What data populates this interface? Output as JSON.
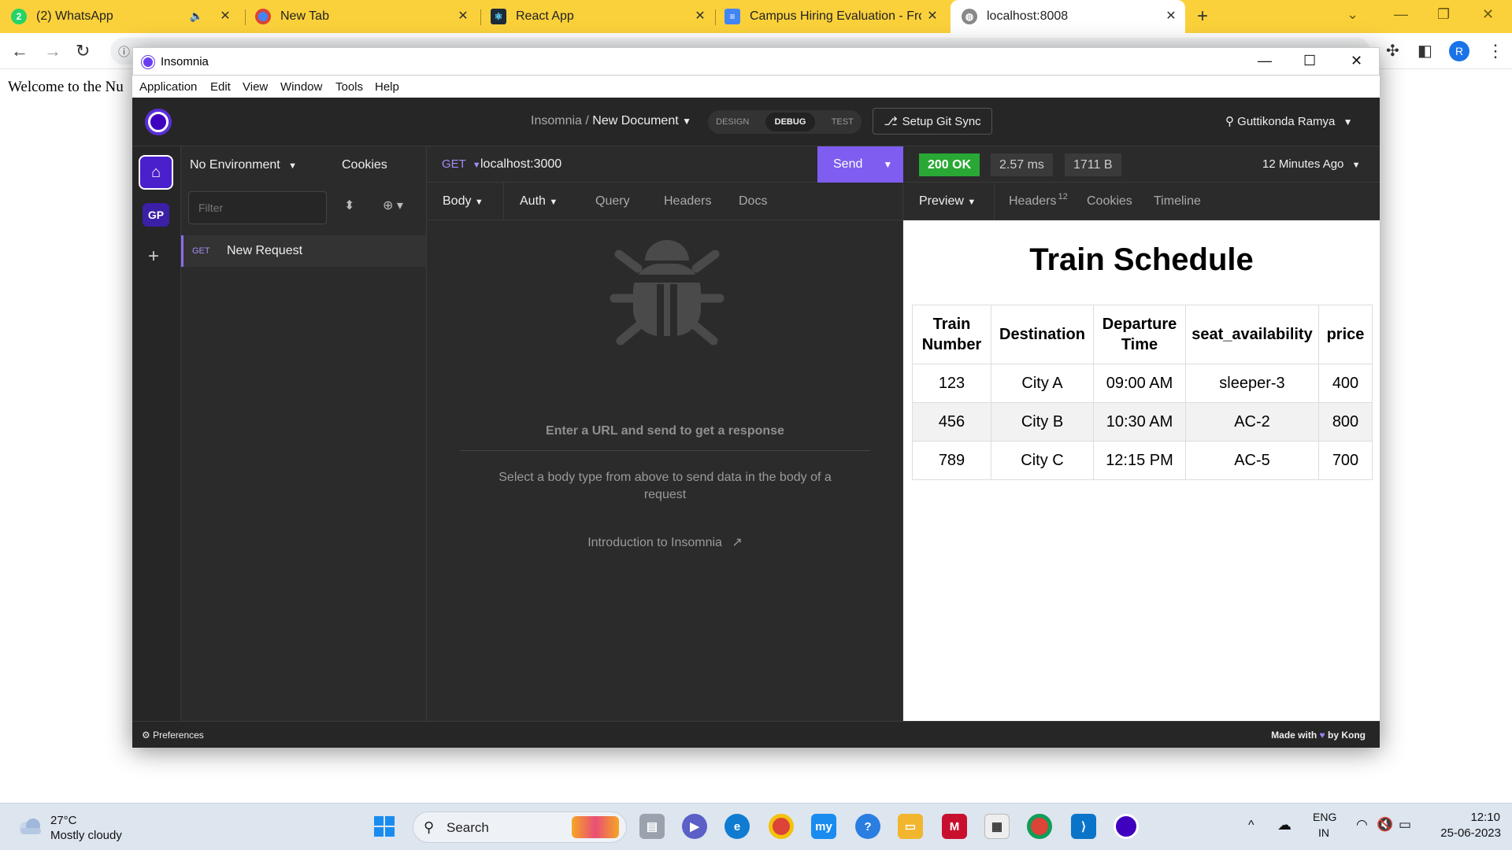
{
  "browser": {
    "tabs": [
      {
        "title": "(2) WhatsApp",
        "icon": "whatsapp-icon"
      },
      {
        "title": "New Tab",
        "icon": "chrome-icon"
      },
      {
        "title": "React App",
        "icon": "react-icon"
      },
      {
        "title": "Campus Hiring Evaluation - Fron",
        "icon": "docs-icon"
      },
      {
        "title": "localhost:8008",
        "icon": "globe-icon"
      }
    ],
    "whatsapp_badge": "2",
    "profile_initial": "R",
    "page_text": "Welcome to the Nu"
  },
  "insomnia": {
    "window_title": "Insomnia",
    "menu": [
      "Application",
      "Edit",
      "View",
      "Window",
      "Tools",
      "Help"
    ],
    "breadcrumb_root": "Insomnia",
    "breadcrumb_sep": "/",
    "document_name": "New Document",
    "modes": [
      "DESIGN",
      "DEBUG",
      "TEST"
    ],
    "git_sync": "Setup Git Sync",
    "user_name": "Guttikonda Ramya",
    "rail_workspace": "GP",
    "environment": "No Environment",
    "cookies": "Cookies",
    "filter_placeholder": "Filter",
    "request": {
      "method": "GET",
      "name": "New Request"
    },
    "url_method": "GET",
    "url": "localhost:3000",
    "send": "Send",
    "request_tabs": [
      "Body",
      "Auth",
      "Query",
      "Headers",
      "Docs"
    ],
    "empty_title": "Enter a URL and send to get a response",
    "empty_hint": "Select a body type from above to send data in the body of a request",
    "intro_link": "Introduction to Insomnia",
    "status": "200 OK",
    "time": "2.57 ms",
    "size": "1711 B",
    "age": "12 Minutes Ago",
    "response_tabs": [
      "Preview",
      "Headers",
      "Cookies",
      "Timeline"
    ],
    "headers_count": "12",
    "footer_prefs": "Preferences",
    "footer_made_with": "Made with",
    "footer_by": "by Kong"
  },
  "preview": {
    "title": "Train Schedule",
    "columns": [
      "Train Number",
      "Destination",
      "Departure Time",
      "seat_availability",
      "price"
    ],
    "rows": [
      [
        "123",
        "City A",
        "09:00 AM",
        "sleeper-3",
        "400"
      ],
      [
        "456",
        "City B",
        "10:30 AM",
        "AC-2",
        "800"
      ],
      [
        "789",
        "City C",
        "12:15 PM",
        "AC-5",
        "700"
      ]
    ]
  },
  "taskbar": {
    "temperature": "27°C",
    "weather": "Mostly cloudy",
    "search": "Search",
    "lang": "ENG",
    "region": "IN",
    "time": "12:10",
    "date": "25-06-2023"
  },
  "colors": {
    "tabbar": "#fbd13b",
    "insomnia_accent": "#7f5df0",
    "status_ok": "#2aa835"
  }
}
